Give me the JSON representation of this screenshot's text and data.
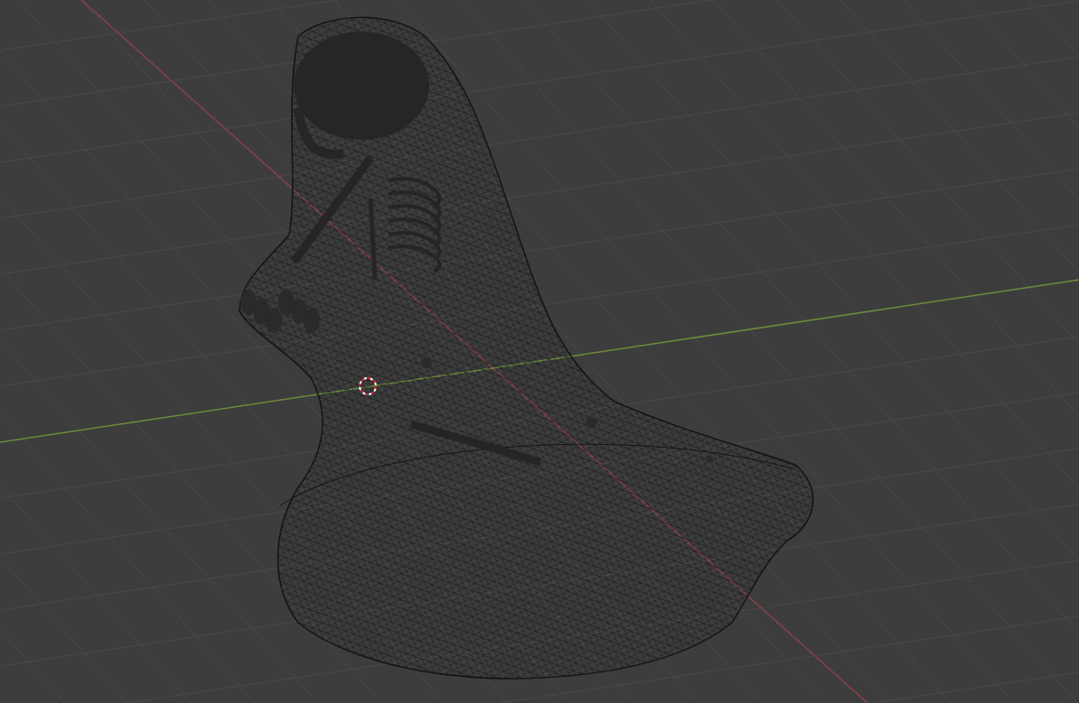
{
  "viewport": {
    "kind": "wireframe"
  }
}
